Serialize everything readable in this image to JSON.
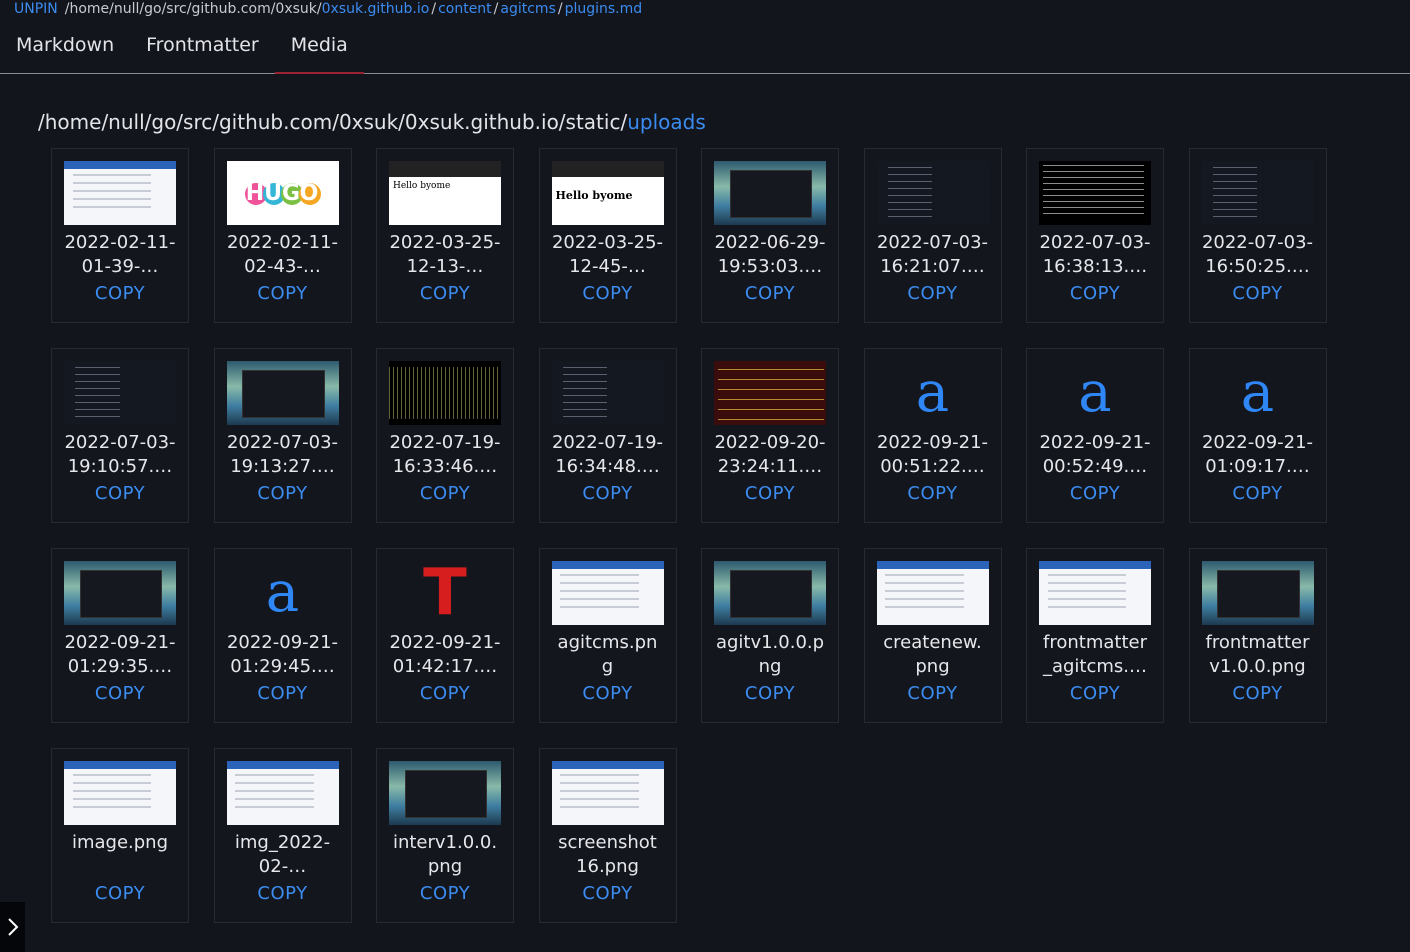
{
  "breadcrumb": {
    "unpin": "UNPIN",
    "prefix": "/home/null/go/src/github.com/0xsuk/",
    "parts": [
      "0xsuk.github.io",
      "content",
      "agitcms",
      "plugins.md"
    ]
  },
  "tabs": [
    "Markdown",
    "Frontmatter",
    "Media"
  ],
  "active_tab": "Media",
  "path": {
    "prefix": "/home/null/go/src/github.com/0xsuk/0xsuk.github.io/static/",
    "link": "uploads"
  },
  "copy_label": "COPY",
  "media": [
    {
      "name": "2022-02-11-\n01-39-…",
      "thumb": "shot"
    },
    {
      "name": "2022-02-11-\n02-43-…",
      "thumb": "hugo",
      "thumb_text": "HUGO"
    },
    {
      "name": "2022-03-25-\n12-13-…",
      "thumb": "hello-small",
      "thumb_text": "Hello byome"
    },
    {
      "name": "2022-03-25-\n12-45-…",
      "thumb": "hello",
      "thumb_text": "Hello byome"
    },
    {
      "name": "2022-06-29-\n19:53:03.…",
      "thumb": "ocean"
    },
    {
      "name": "2022-07-03-\n16:21:07.…",
      "thumb": "darkui"
    },
    {
      "name": "2022-07-03-\n16:38:13.…",
      "thumb": "term"
    },
    {
      "name": "2022-07-03-\n16:50:25.…",
      "thumb": "darkui"
    },
    {
      "name": "2022-07-03-\n19:10:57.…",
      "thumb": "darkui"
    },
    {
      "name": "2022-07-03-\n19:13:27.…",
      "thumb": "ocean"
    },
    {
      "name": "2022-07-19-\n16:33:46.…",
      "thumb": "wave"
    },
    {
      "name": "2022-07-19-\n16:34:48.…",
      "thumb": "darkui"
    },
    {
      "name": "2022-09-20-\n23:24:11.…",
      "thumb": "red"
    },
    {
      "name": "2022-09-21-\n00:51:22.…",
      "thumb": "glyph-a",
      "thumb_text": "a"
    },
    {
      "name": "2022-09-21-\n00:52:49.…",
      "thumb": "glyph-a",
      "thumb_text": "a"
    },
    {
      "name": "2022-09-21-\n01:09:17.…",
      "thumb": "glyph-a",
      "thumb_text": "a"
    },
    {
      "name": "2022-09-21-\n01:29:35.…",
      "thumb": "ocean"
    },
    {
      "name": "2022-09-21-\n01:29:45.…",
      "thumb": "glyph-a",
      "thumb_text": "a"
    },
    {
      "name": "2022-09-21-\n01:42:17.…",
      "thumb": "glyph-t",
      "thumb_text": "T"
    },
    {
      "name": "agitcms.pn\ng",
      "thumb": "shot"
    },
    {
      "name": "agitv1.0.0.p\nng",
      "thumb": "ocean"
    },
    {
      "name": "createnew.\npng",
      "thumb": "shot"
    },
    {
      "name": "frontmatter\n_agitcms.…",
      "thumb": "shot"
    },
    {
      "name": "frontmatter\nv1.0.0.png",
      "thumb": "ocean"
    },
    {
      "name": "image.png",
      "thumb": "shot"
    },
    {
      "name": "img_2022-\n02-…",
      "thumb": "shot"
    },
    {
      "name": "interv1.0.0.\npng",
      "thumb": "ocean"
    },
    {
      "name": "screenshot\n16.png",
      "thumb": "shot"
    }
  ],
  "colors": {
    "accent": "#3b8cf0",
    "background": "#13151d",
    "tab_indicator": "#9b2230"
  },
  "icons": {
    "drawer_toggle": "chevron-right-icon"
  }
}
